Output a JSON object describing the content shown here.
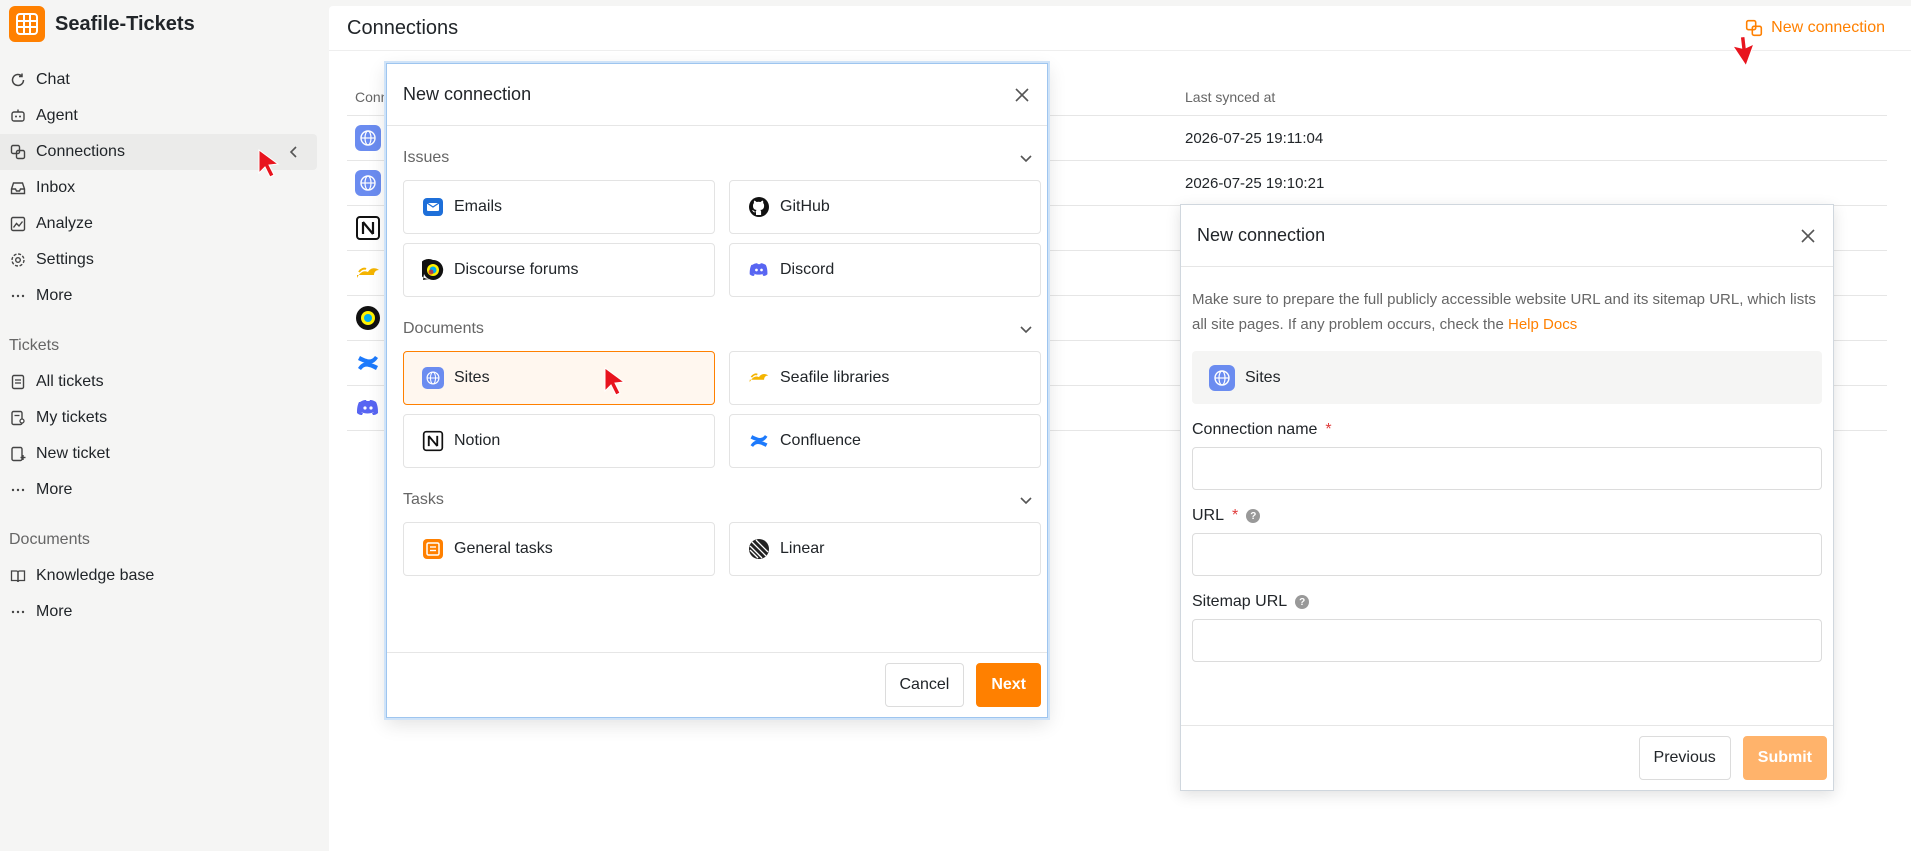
{
  "app": {
    "name": "Seafile-Tickets"
  },
  "sidebar": {
    "items": [
      {
        "label": "Chat",
        "icon": "chat-icon"
      },
      {
        "label": "Agent",
        "icon": "robot-icon"
      },
      {
        "label": "Connections",
        "icon": "connections-icon",
        "active": true
      },
      {
        "label": "Inbox",
        "icon": "inbox-icon"
      },
      {
        "label": "Analyze",
        "icon": "chart-icon"
      },
      {
        "label": "Settings",
        "icon": "gear-icon"
      },
      {
        "label": "More",
        "icon": "more-icon"
      }
    ],
    "tickets_title": "Tickets",
    "tickets": [
      {
        "label": "All tickets",
        "icon": "list-icon"
      },
      {
        "label": "My tickets",
        "icon": "user-list-icon"
      },
      {
        "label": "New ticket",
        "icon": "add-list-icon"
      },
      {
        "label": "More",
        "icon": "more-icon"
      }
    ],
    "documents_title": "Documents",
    "documents": [
      {
        "label": "Knowledge base",
        "icon": "book-icon"
      },
      {
        "label": "More",
        "icon": "more-icon"
      }
    ]
  },
  "main": {
    "title": "Connections",
    "new_connection": "New connection",
    "table": {
      "col_connection": "Conn",
      "col_last_synced": "Last synced at",
      "rows": [
        {
          "icon": "globe-icon",
          "synced": "2026-07-25 19:11:04"
        },
        {
          "icon": "globe-icon",
          "synced": "2026-07-25 19:10:21"
        },
        {
          "icon": "notion-icon",
          "synced": ""
        },
        {
          "icon": "seafile-icon",
          "synced": ""
        },
        {
          "icon": "discourse-icon",
          "synced": ""
        },
        {
          "icon": "confluence-icon",
          "synced": ""
        },
        {
          "icon": "discord-icon",
          "synced": ""
        }
      ]
    }
  },
  "modal1": {
    "title": "New connection",
    "groups": [
      {
        "name": "Issues",
        "options": [
          "Emails",
          "GitHub",
          "Discourse forums",
          "Discord"
        ]
      },
      {
        "name": "Documents",
        "options": [
          "Sites",
          "Seafile libraries",
          "Notion",
          "Confluence"
        ]
      },
      {
        "name": "Tasks",
        "options": [
          "General tasks",
          "Linear"
        ]
      }
    ],
    "selected": "Sites",
    "cancel": "Cancel",
    "next": "Next"
  },
  "modal2": {
    "title": "New connection",
    "description": "Make sure to prepare the full publicly accessible website URL and its sitemap URL, which lists all site pages. If any problem occurs, check the",
    "help_link": "Help Docs",
    "type_label": "Sites",
    "connection_name_label": "Connection name",
    "url_label": "URL",
    "sitemap_label": "Sitemap URL",
    "required_mark": "*",
    "help_mark": "?",
    "connection_name_value": "",
    "url_value": "",
    "sitemap_value": "",
    "previous": "Previous",
    "submit": "Submit"
  },
  "colors": {
    "accent": "#ff8000",
    "sidebar_bg": "#f5f5f4",
    "selected_border": "#ff8000"
  }
}
